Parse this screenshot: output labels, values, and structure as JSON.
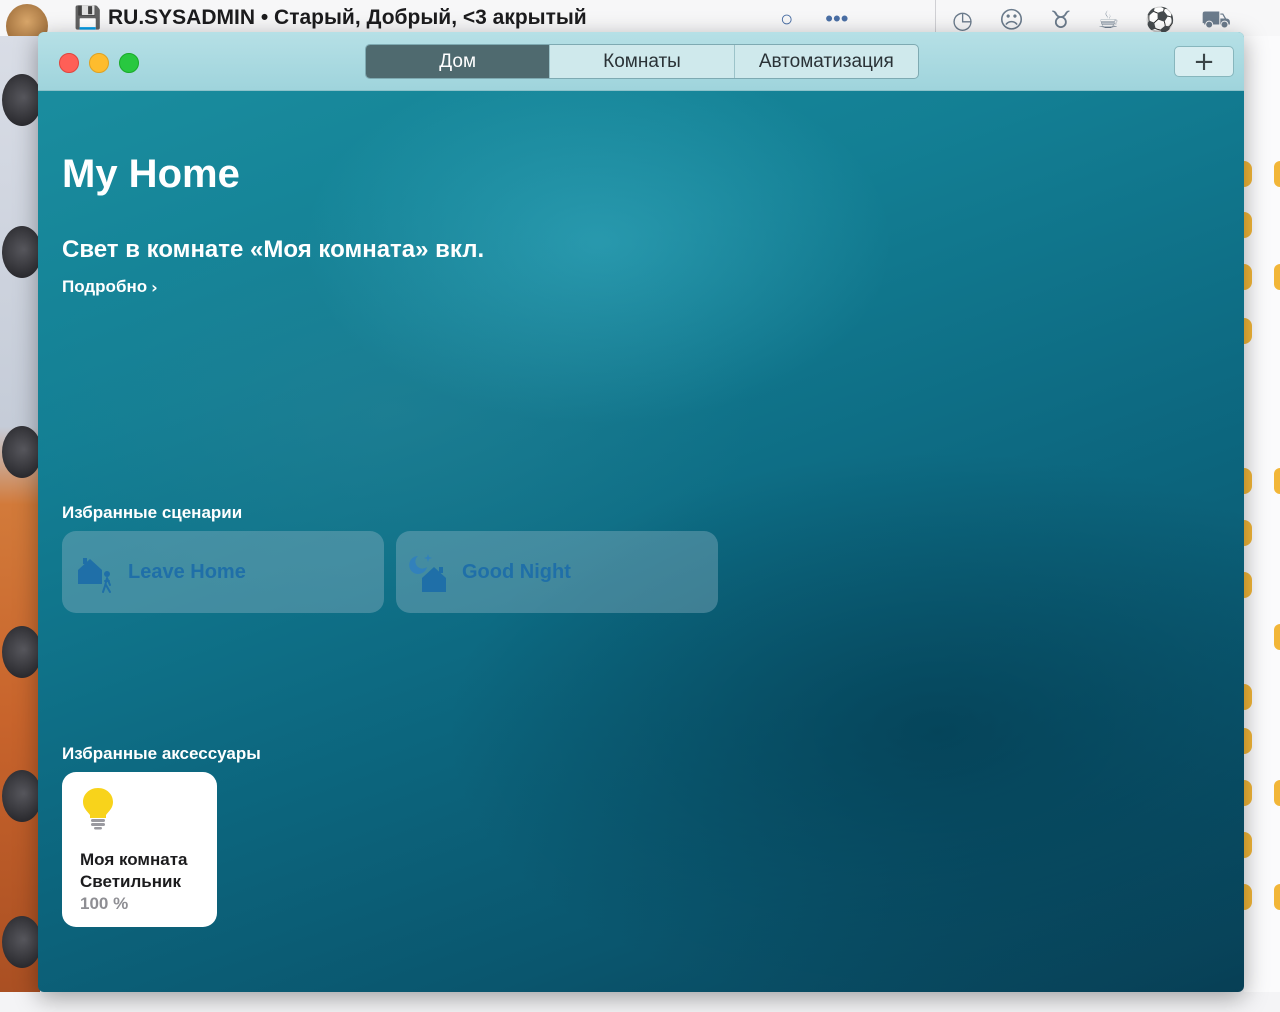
{
  "background_app": {
    "chat_title": "RU.SYSADMIN • Старый, Добрый, <3 акрытый"
  },
  "window": {
    "tabs": [
      {
        "label": "Дом",
        "active": true
      },
      {
        "label": "Комнаты",
        "active": false
      },
      {
        "label": "Автоматизация",
        "active": false
      }
    ],
    "add_button": "+"
  },
  "home": {
    "title": "My Home",
    "status": "Свет в комнате «Моя комната» вкл.",
    "details_link": "Подробно",
    "details_chevron": "›"
  },
  "scenes": {
    "label": "Избранные сценарии",
    "items": [
      {
        "name": "Leave Home",
        "icon": "leave-home-icon"
      },
      {
        "name": "Good Night",
        "icon": "good-night-icon"
      }
    ]
  },
  "accessories": {
    "label": "Избранные аксессуары",
    "items": [
      {
        "room": "Моя комната",
        "device": "Светильник",
        "value": "100 %",
        "icon": "lightbulb-icon"
      }
    ]
  },
  "colors": {
    "scene_text": "#1f6fa8",
    "bulb_on": "#f8d31b",
    "active_tab": "#4f6a6f"
  }
}
